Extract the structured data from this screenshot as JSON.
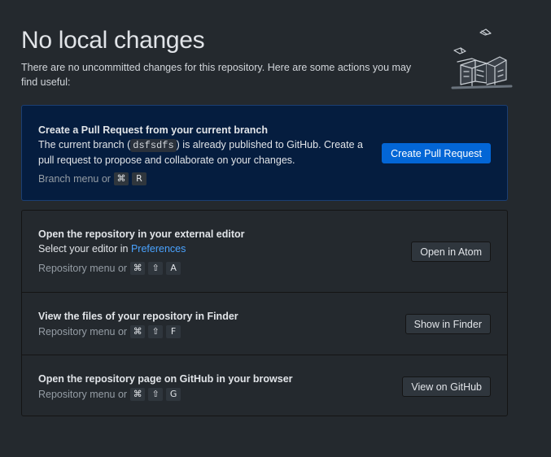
{
  "header": {
    "title": "No local changes",
    "subtitle": "There are no uncommitted changes for this repository. Here are some actions you may find useful:"
  },
  "pull_request": {
    "title": "Create a Pull Request from your current branch",
    "desc_prefix": "The current branch (",
    "branch": "dsfsdfs",
    "desc_suffix": ") is already published to GitHub. Create a pull request to propose and collaborate on your changes.",
    "shortcut_label": "Branch menu or",
    "keys": [
      "⌘",
      "R"
    ],
    "button": "Create Pull Request"
  },
  "actions": [
    {
      "title": "Open the repository in your external editor",
      "desc_prefix": "Select your editor in ",
      "desc_link": "Preferences",
      "shortcut_label": "Repository menu or",
      "keys": [
        "⌘",
        "⇧",
        "A"
      ],
      "button": "Open in Atom"
    },
    {
      "title": "View the files of your repository in Finder",
      "shortcut_label": "Repository menu or",
      "keys": [
        "⌘",
        "⇧",
        "F"
      ],
      "button": "Show in Finder"
    },
    {
      "title": "Open the repository page on GitHub in your browser",
      "shortcut_label": "Repository menu or",
      "keys": [
        "⌘",
        "⇧",
        "G"
      ],
      "button": "View on GitHub"
    }
  ],
  "colors": {
    "background": "#24292e",
    "pr_card": "#051d3f",
    "primary_button": "#0366d6",
    "link": "#4aa3ff"
  }
}
